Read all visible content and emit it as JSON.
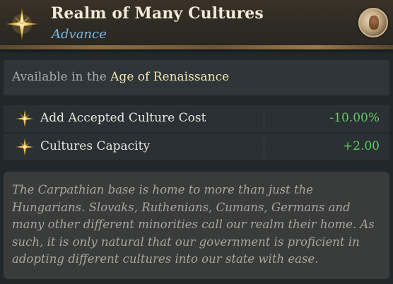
{
  "header": {
    "title": "Realm of Many Cultures",
    "subtitle": "Advance",
    "icon": "compass-star-icon",
    "avatar": "character-portrait-avatar"
  },
  "availability": {
    "prefix": "Available in the ",
    "era": "Age of Renaissance"
  },
  "modifiers": [
    {
      "icon": "star-bullet-icon",
      "label": "Add Accepted Culture Cost",
      "value": "-10.00%"
    },
    {
      "icon": "star-bullet-icon",
      "label": "Cultures Capacity",
      "value": "+2.00"
    }
  ],
  "flavor": {
    "text": "The Carpathian base is home to more than just the Hungarians. Slovaks, Ruthenians, Cumans, Germans and many other different minorities call our realm their home. As such, it is only natural that our government is proficient in adopting different cultures into our state with ease."
  },
  "colors": {
    "title": "#f1e9d8",
    "subtitle": "#7ab6e0",
    "era": "#f2e4b4",
    "positive_value": "#5ccd5e",
    "flavor_text": "#a7a59d"
  }
}
